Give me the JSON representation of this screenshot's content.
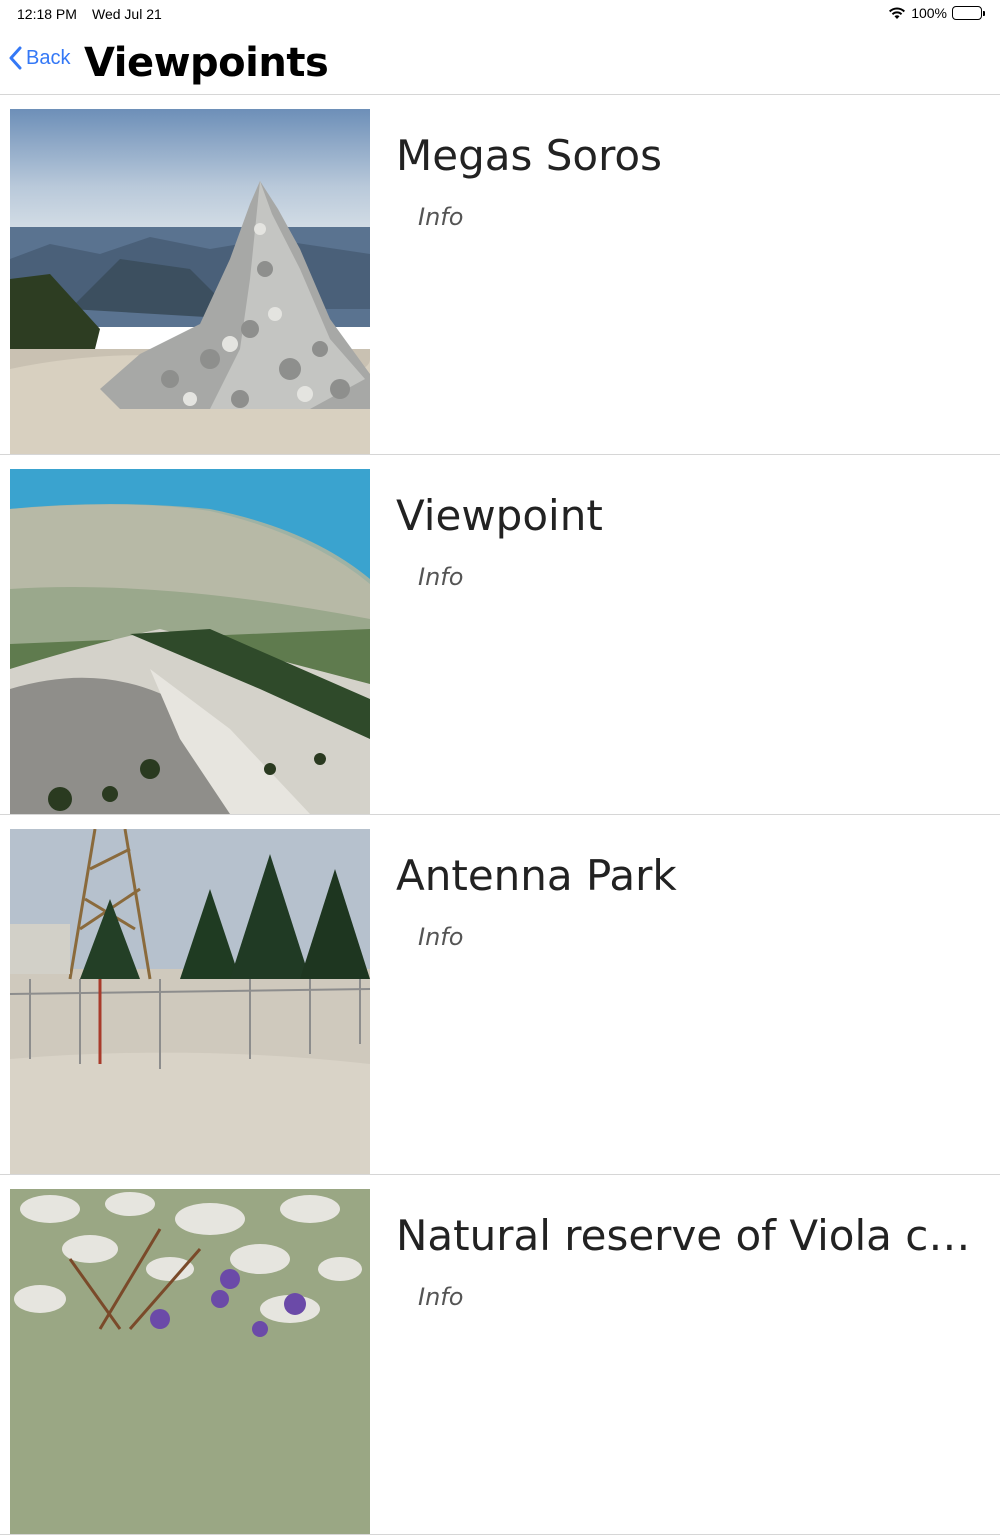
{
  "status_bar": {
    "time": "12:18 PM",
    "date": "Wed Jul 21",
    "battery": "100%",
    "icons": [
      "wifi-icon",
      "battery-icon"
    ]
  },
  "nav": {
    "back_label": "Back",
    "title": "Viewpoints",
    "accent_color": "#3478f6"
  },
  "items": [
    {
      "title": "Megas Soros",
      "info_label": "Info",
      "image": "stone-cairn-photo"
    },
    {
      "title": "Viewpoint",
      "info_label": "Info",
      "image": "mountain-coast-photo"
    },
    {
      "title": "Antenna Park",
      "info_label": "Info",
      "image": "antenna-fir-trees-photo"
    },
    {
      "title": "Natural reserve of Viola cep...",
      "info_label": "Info",
      "image": "violets-rocks-photo"
    }
  ]
}
